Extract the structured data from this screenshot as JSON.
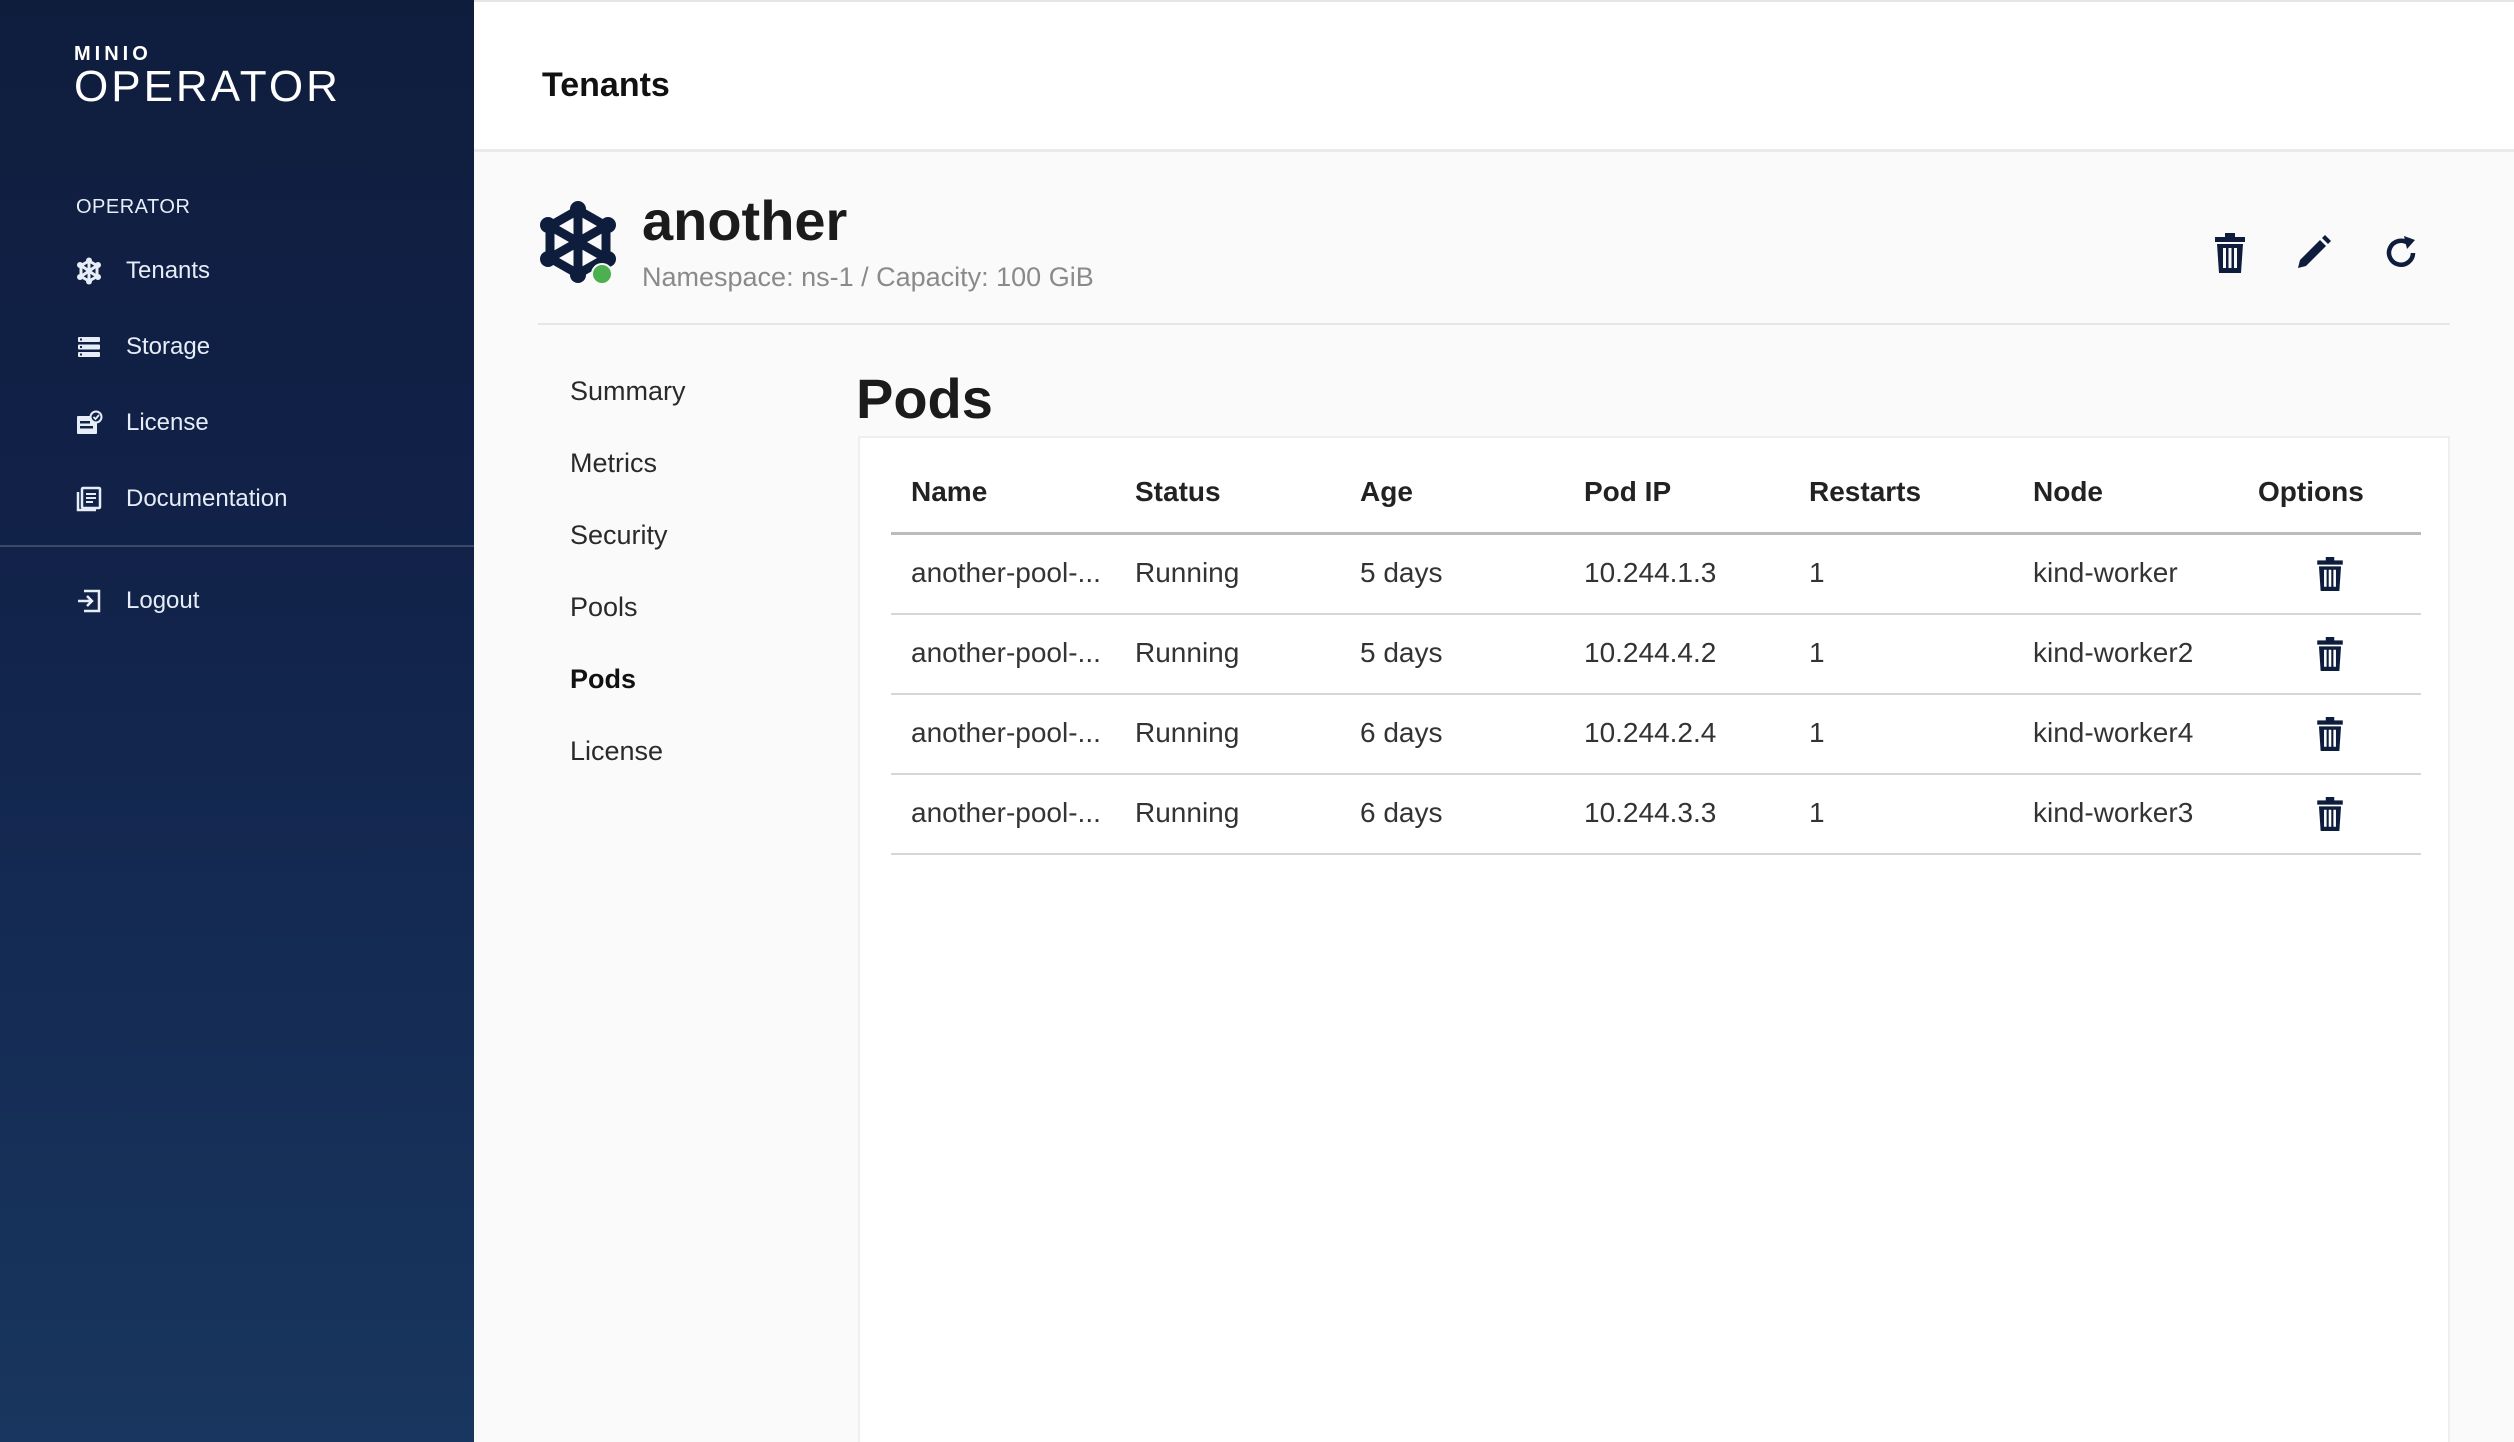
{
  "logo": {
    "brand": "MINIO",
    "product": "OPERATOR"
  },
  "sidebar": {
    "section": "OPERATOR",
    "items": [
      {
        "label": "Tenants",
        "icon": "tenants-icon"
      },
      {
        "label": "Storage",
        "icon": "storage-icon"
      },
      {
        "label": "License",
        "icon": "license-icon"
      },
      {
        "label": "Documentation",
        "icon": "documentation-icon"
      }
    ],
    "logout": "Logout"
  },
  "header": {
    "title": "Tenants"
  },
  "tenant": {
    "name": "another",
    "subtitle": "Namespace: ns-1 / Capacity: 100 GiB",
    "status_color": "#4caf50"
  },
  "tabs": [
    "Summary",
    "Metrics",
    "Security",
    "Pools",
    "Pods",
    "License"
  ],
  "active_tab": "Pods",
  "pods": {
    "title": "Pods",
    "columns": [
      "Name",
      "Status",
      "Age",
      "Pod IP",
      "Restarts",
      "Node",
      "Options"
    ],
    "rows": [
      {
        "name": "another-pool-...",
        "status": "Running",
        "age": "5 days",
        "ip": "10.244.1.3",
        "restarts": "1",
        "node": "kind-worker"
      },
      {
        "name": "another-pool-...",
        "status": "Running",
        "age": "5 days",
        "ip": "10.244.4.2",
        "restarts": "1",
        "node": "kind-worker2"
      },
      {
        "name": "another-pool-...",
        "status": "Running",
        "age": "6 days",
        "ip": "10.244.2.4",
        "restarts": "1",
        "node": "kind-worker4"
      },
      {
        "name": "another-pool-...",
        "status": "Running",
        "age": "6 days",
        "ip": "10.244.3.3",
        "restarts": "1",
        "node": "kind-worker3"
      }
    ]
  },
  "colors": {
    "sidebar": "#112148",
    "icon_dark": "#0f1d3d",
    "accent_green": "#4caf50"
  }
}
